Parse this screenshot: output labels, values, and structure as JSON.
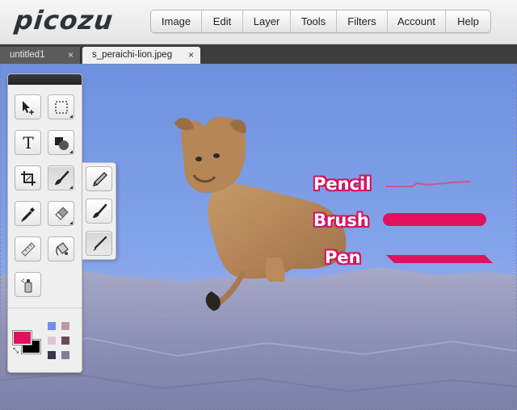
{
  "app": {
    "logo": "picozu"
  },
  "menu": {
    "items": [
      "Image",
      "Edit",
      "Layer",
      "Tools",
      "Filters",
      "Account",
      "Help"
    ]
  },
  "tabs": [
    {
      "label": "untitled1",
      "close": "×",
      "active": false
    },
    {
      "label": "s_peraichi-lion.jpeg",
      "close": "×",
      "active": true
    }
  ],
  "tools": {
    "left": [
      "move-icon",
      "text-icon",
      "crop-icon",
      "eyedropper-icon",
      "ruler-icon",
      "spray-can-icon"
    ],
    "right": [
      "marquee-icon",
      "shape-icon",
      "brush-icon",
      "eraser-icon",
      "paint-bucket-icon"
    ],
    "flyout": [
      "pencil-icon",
      "brush-icon",
      "pen-icon"
    ]
  },
  "colors": {
    "foreground": "#e0125e",
    "background": "#000000",
    "swatches": [
      "#6f8ff0",
      "#b99aa8",
      "#e1c3d8",
      "#6d4860",
      "#3a3548",
      "#7f7f9a"
    ],
    "annotation": "#d31462"
  },
  "annotations": {
    "pencil": "Pencil",
    "brush": "Brush",
    "pen": "Pen"
  }
}
